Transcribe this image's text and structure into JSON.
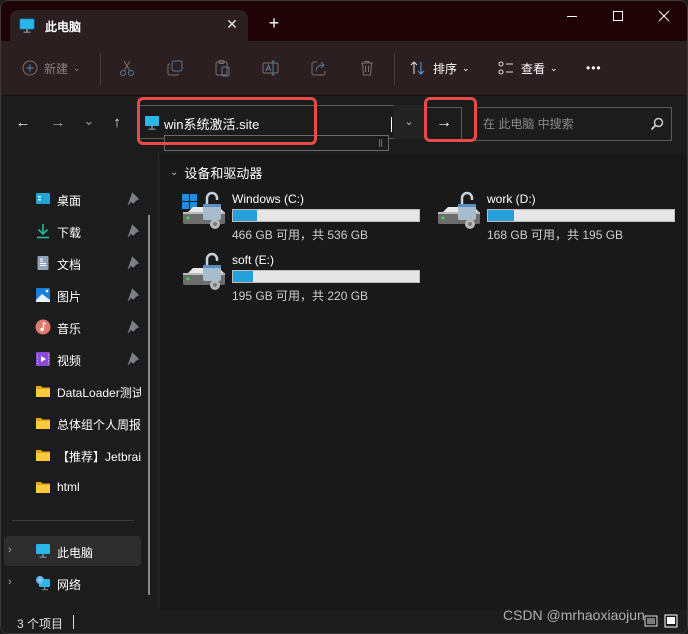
{
  "window": {
    "tab_title": "此电脑",
    "tab_icon": "this-pc-icon",
    "new_tab_symbol": "+",
    "close_tab_symbol": "✕"
  },
  "toolbar": {
    "new_label": "新建",
    "sort_label": "排序",
    "view_label": "查看",
    "more_symbol": "•••",
    "icons": [
      "new-icon",
      "cut-icon",
      "copy-icon",
      "paste-icon",
      "rename-icon",
      "share-icon",
      "delete-icon",
      "sort-icon",
      "view-icon",
      "more-icon"
    ]
  },
  "navigation": {
    "back_symbol": "←",
    "forward_symbol": "→",
    "recent_symbol": "⌄",
    "up_symbol": "↑",
    "address_value": "win系统激活.site",
    "dropdown_symbol": "⌄",
    "go_symbol": "→",
    "search_placeholder": "在 此电脑 中搜索"
  },
  "sidebar": {
    "quick_access": [
      {
        "label": "桌面",
        "icon": "desktop-icon",
        "pinned": true
      },
      {
        "label": "下载",
        "icon": "download-icon",
        "pinned": true
      },
      {
        "label": "文档",
        "icon": "documents-icon",
        "pinned": true
      },
      {
        "label": "图片",
        "icon": "pictures-icon",
        "pinned": true
      },
      {
        "label": "音乐",
        "icon": "music-icon",
        "pinned": true
      },
      {
        "label": "视频",
        "icon": "videos-icon",
        "pinned": true
      },
      {
        "label": "DataLoader测试",
        "icon": "folder-icon",
        "pinned": false
      },
      {
        "label": "总体组个人周报",
        "icon": "folder-icon",
        "pinned": false
      },
      {
        "label": "【推荐】Jetbrains",
        "icon": "folder-icon",
        "pinned": false
      },
      {
        "label": "html",
        "icon": "folder-icon",
        "pinned": false
      }
    ],
    "locations": [
      {
        "label": "此电脑",
        "icon": "this-pc-icon",
        "selected": true
      },
      {
        "label": "网络",
        "icon": "network-icon",
        "selected": false
      }
    ]
  },
  "main": {
    "group_title": "设备和驱动器",
    "drives": [
      {
        "name": "Windows (C:)",
        "info": "466 GB 可用，共 536 GB",
        "used_fraction": 0.13,
        "system": true
      },
      {
        "name": "work (D:)",
        "info": "168 GB 可用，共 195 GB",
        "used_fraction": 0.14,
        "system": false
      },
      {
        "name": "soft (E:)",
        "info": "195 GB 可用，共 220 GB",
        "used_fraction": 0.11,
        "system": false
      }
    ]
  },
  "status": {
    "item_count": "3 个项目"
  },
  "watermark": "CSDN @mrhaoxiaojun",
  "colors": {
    "accent": "#26a0da",
    "highlight": "#e84a4a",
    "titlebar": "#1f0205",
    "commandbar": "#2c1f21"
  }
}
